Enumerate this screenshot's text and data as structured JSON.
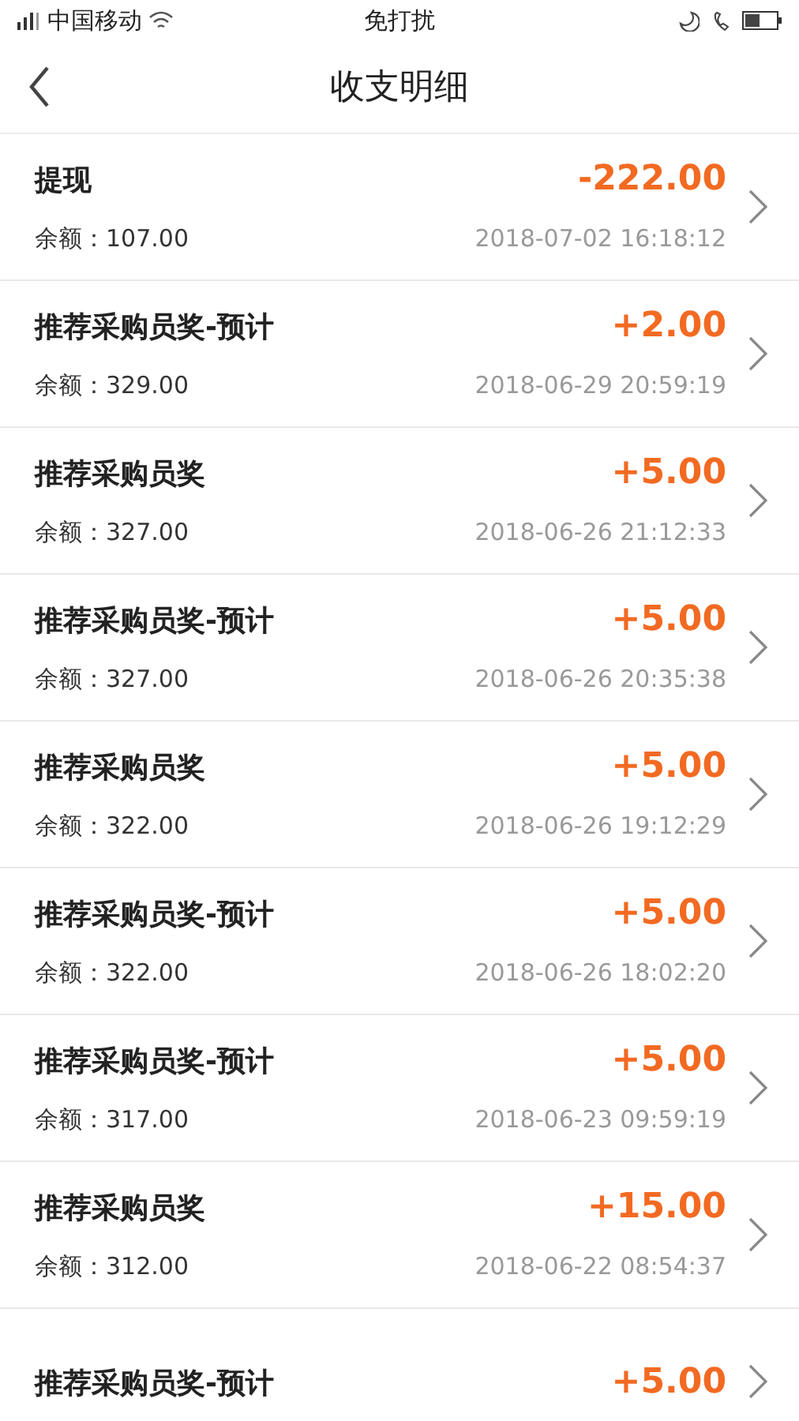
{
  "status_bar": {
    "carrier": "中国移动",
    "mode": "免打扰"
  },
  "header": {
    "title": "收支明细"
  },
  "records": [
    {
      "title": "提现",
      "amount": "-222.00",
      "balance": "余额：107.00",
      "time": "2018-07-02 16:18:12"
    },
    {
      "title": "推荐采购员奖-预计",
      "amount": "+2.00",
      "balance": "余额：329.00",
      "time": "2018-06-29 20:59:19"
    },
    {
      "title": "推荐采购员奖",
      "amount": "+5.00",
      "balance": "余额：327.00",
      "time": "2018-06-26 21:12:33"
    },
    {
      "title": "推荐采购员奖-预计",
      "amount": "+5.00",
      "balance": "余额：327.00",
      "time": "2018-06-26 20:35:38"
    },
    {
      "title": "推荐采购员奖",
      "amount": "+5.00",
      "balance": "余额：322.00",
      "time": "2018-06-26 19:12:29"
    },
    {
      "title": "推荐采购员奖-预计",
      "amount": "+5.00",
      "balance": "余额：322.00",
      "time": "2018-06-26 18:02:20"
    },
    {
      "title": "推荐采购员奖-预计",
      "amount": "+5.00",
      "balance": "余额：317.00",
      "time": "2018-06-23 09:59:19"
    },
    {
      "title": "推荐采购员奖",
      "amount": "+15.00",
      "balance": "余额：312.00",
      "time": "2018-06-22 08:54:37"
    },
    {
      "title": "推荐采购员奖-预计",
      "amount": "+5.00"
    }
  ]
}
